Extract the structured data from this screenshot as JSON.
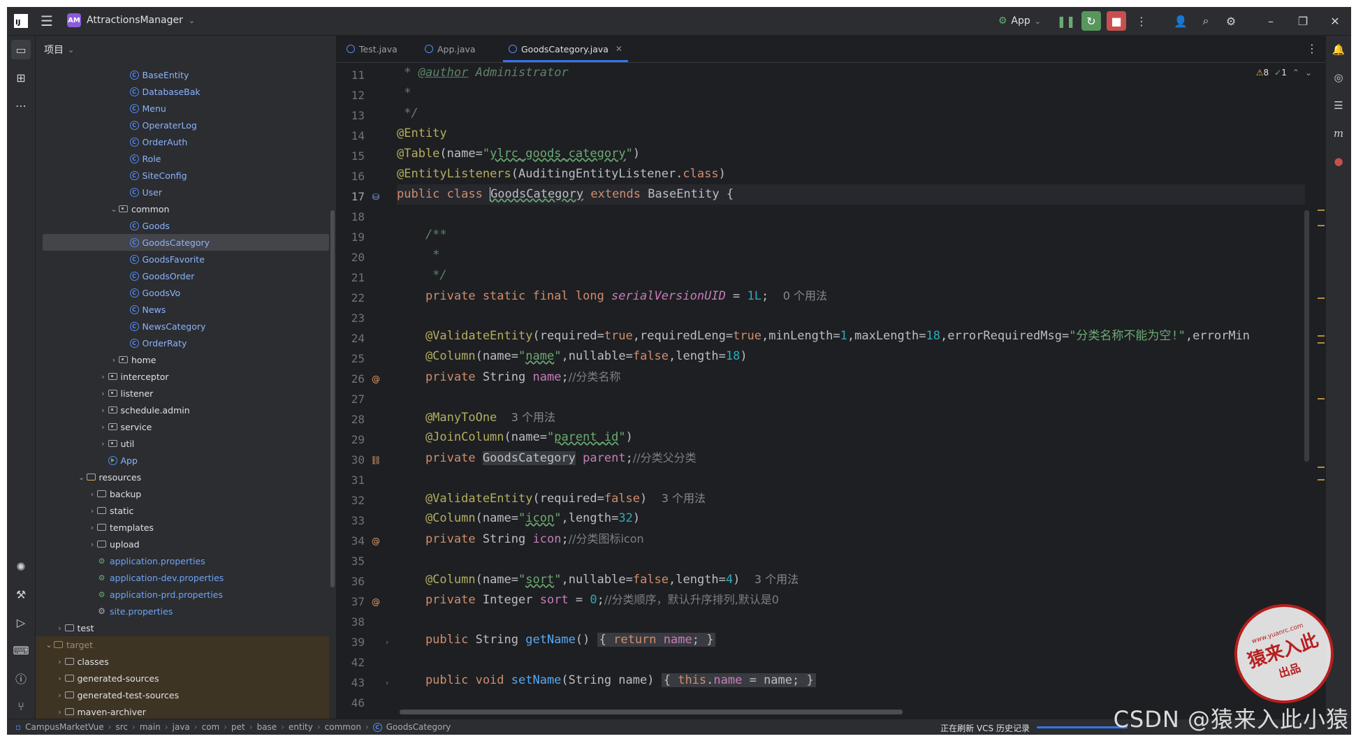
{
  "titlebar": {
    "project_badge": "AM",
    "project_name": "AttractionsManager",
    "run_config": "App",
    "icons": [
      "hamburger-menu-icon",
      "run-config-icon",
      "debug-icon",
      "rerun-icon",
      "stop-icon",
      "more-icon",
      "add-user-icon",
      "search-icon",
      "settings-icon"
    ],
    "window_controls": [
      "minimize",
      "restore",
      "close"
    ]
  },
  "project_panel": {
    "title": "项目",
    "tree": [
      {
        "label": "BaseEntity",
        "kind": "class",
        "depth": 8
      },
      {
        "label": "DatabaseBak",
        "kind": "class",
        "depth": 8
      },
      {
        "label": "Menu",
        "kind": "class",
        "depth": 8
      },
      {
        "label": "OperaterLog",
        "kind": "class",
        "depth": 8
      },
      {
        "label": "OrderAuth",
        "kind": "class",
        "depth": 8
      },
      {
        "label": "Role",
        "kind": "class",
        "depth": 8
      },
      {
        "label": "SiteConfig",
        "kind": "class",
        "depth": 8
      },
      {
        "label": "User",
        "kind": "class",
        "depth": 8
      },
      {
        "label": "common",
        "kind": "package",
        "depth": 7,
        "expanded": true
      },
      {
        "label": "Goods",
        "kind": "class",
        "depth": 8
      },
      {
        "label": "GoodsCategory",
        "kind": "class",
        "depth": 8,
        "selected": true
      },
      {
        "label": "GoodsFavorite",
        "kind": "class",
        "depth": 8
      },
      {
        "label": "GoodsOrder",
        "kind": "class",
        "depth": 8
      },
      {
        "label": "GoodsVo",
        "kind": "class",
        "depth": 8
      },
      {
        "label": "News",
        "kind": "class",
        "depth": 8
      },
      {
        "label": "NewsCategory",
        "kind": "class",
        "depth": 8
      },
      {
        "label": "OrderRaty",
        "kind": "class",
        "depth": 8
      },
      {
        "label": "home",
        "kind": "package",
        "depth": 7,
        "expanded": false
      },
      {
        "label": "interceptor",
        "kind": "package",
        "depth": 6,
        "expanded": false
      },
      {
        "label": "listener",
        "kind": "package",
        "depth": 6,
        "expanded": false
      },
      {
        "label": "schedule.admin",
        "kind": "package",
        "depth": 6,
        "expanded": false
      },
      {
        "label": "service",
        "kind": "package",
        "depth": 6,
        "expanded": false
      },
      {
        "label": "util",
        "kind": "package",
        "depth": 6,
        "expanded": false
      },
      {
        "label": "App",
        "kind": "app",
        "depth": 6
      },
      {
        "label": "resources",
        "kind": "resources",
        "depth": 4,
        "expanded": true
      },
      {
        "label": "backup",
        "kind": "folder",
        "depth": 5,
        "expanded": false
      },
      {
        "label": "static",
        "kind": "folder",
        "depth": 5,
        "expanded": false
      },
      {
        "label": "templates",
        "kind": "folder",
        "depth": 5,
        "expanded": false
      },
      {
        "label": "upload",
        "kind": "folder",
        "depth": 5,
        "expanded": false
      },
      {
        "label": "application.properties",
        "kind": "properties",
        "depth": 5
      },
      {
        "label": "application-dev.properties",
        "kind": "properties",
        "depth": 5
      },
      {
        "label": "application-prd.properties",
        "kind": "properties",
        "depth": 5
      },
      {
        "label": "site.properties",
        "kind": "settings",
        "depth": 5
      },
      {
        "label": "test",
        "kind": "folder",
        "depth": 2,
        "expanded": false
      },
      {
        "label": "target",
        "kind": "folder-excluded",
        "depth": 1,
        "expanded": true
      },
      {
        "label": "classes",
        "kind": "folder",
        "depth": 2,
        "expanded": false,
        "excluded": true
      },
      {
        "label": "generated-sources",
        "kind": "folder",
        "depth": 2,
        "expanded": false,
        "excluded": true
      },
      {
        "label": "generated-test-sources",
        "kind": "folder",
        "depth": 2,
        "expanded": false,
        "excluded": true
      },
      {
        "label": "maven-archiver",
        "kind": "folder",
        "depth": 2,
        "expanded": false,
        "excluded": true
      }
    ]
  },
  "editor": {
    "tabs": [
      {
        "label": "Test.java",
        "active": false
      },
      {
        "label": "App.java",
        "active": false
      },
      {
        "label": "GoodsCategory.java",
        "active": true
      }
    ],
    "inspection": {
      "warnings": "8",
      "ok": "1"
    },
    "current_line": "17",
    "lines": [
      {
        "no": "11",
        "t1": " * ",
        "t2": "@author",
        "t3": " Administrator"
      },
      {
        "no": "12",
        "t1": " *"
      },
      {
        "no": "13",
        "t1": " */"
      },
      {
        "no": "14",
        "t1": "@Entity"
      },
      {
        "no": "15",
        "t1": "@Table",
        "t2": "(name=",
        "t3": "\"",
        "t4": "ylrc_goods_category",
        "t5": "\"",
        "t6": ")"
      },
      {
        "no": "16",
        "t1": "@",
        "t2": "EntityListeners",
        "t3": "(AuditingEntityListener.",
        "t4": "class",
        "t5": ")"
      },
      {
        "no": "17",
        "t1": "public class ",
        "t2": "GoodsCategory",
        "t3": " extends ",
        "t4": "BaseEntity {"
      },
      {
        "no": "18"
      },
      {
        "no": "19",
        "t1": "    /**"
      },
      {
        "no": "20",
        "t1": "     *"
      },
      {
        "no": "21",
        "t1": "     */"
      },
      {
        "no": "22",
        "t1": "    private static final long ",
        "t2": "serialVersionUID",
        "t3": " = ",
        "t4": "1L",
        "t5": ";",
        "hint": "0 个用法"
      },
      {
        "no": "23"
      },
      {
        "no": "24",
        "t1": "    @ValidateEntity",
        "t2": "(required=",
        "t3": "true",
        "t4": ",requiredLeng=",
        "t5": "true",
        "t6": ",minLength=",
        "t7": "1",
        "t8": ",maxLength=",
        "t9": "18",
        "t10": ",errorRequiredMsg=",
        "t11": "\"分类名称不能为空!\"",
        "t12": ",errorMin"
      },
      {
        "no": "25",
        "t1": "    @Column",
        "t2": "(name=",
        "t3": "\"",
        "t4": "name",
        "t5": "\"",
        "t6": ",nullable=",
        "t7": "false",
        "t8": ",length=",
        "t9": "18",
        "t10": ")"
      },
      {
        "no": "26",
        "t1": "    private ",
        "t2": "String ",
        "t3": "name",
        "t4": ";",
        "cmt": "//分类名称"
      },
      {
        "no": "27"
      },
      {
        "no": "28",
        "t1": "    @ManyToOne",
        "hint": "3 个用法"
      },
      {
        "no": "29",
        "t1": "    @JoinColumn",
        "t2": "(name=",
        "t3": "\"",
        "t4": "parent_id",
        "t5": "\"",
        "t6": ")"
      },
      {
        "no": "30",
        "t1": "    private ",
        "t2": "GoodsCategory",
        "t3": " ",
        "t4": "parent",
        "t5": ";",
        "cmt": "//分类父分类"
      },
      {
        "no": "31"
      },
      {
        "no": "32",
        "t1": "    @ValidateEntity",
        "t2": "(required=",
        "t3": "false",
        "t4": ")",
        "hint": "3 个用法"
      },
      {
        "no": "33",
        "t1": "    @Column",
        "t2": "(name=",
        "t3": "\"",
        "t4": "icon",
        "t5": "\"",
        "t6": ",length=",
        "t7": "32",
        "t8": ")"
      },
      {
        "no": "34",
        "t1": "    private ",
        "t2": "String ",
        "t3": "icon",
        "t4": ";",
        "cmt": "//分类图标icon"
      },
      {
        "no": "35"
      },
      {
        "no": "36",
        "t1": "    @Column",
        "t2": "(name=",
        "t3": "\"",
        "t4": "sort",
        "t5": "\"",
        "t6": ",nullable=",
        "t7": "false",
        "t8": ",length=",
        "t9": "4",
        "t10": ")",
        "hint": "3 个用法"
      },
      {
        "no": "37",
        "t1": "    private ",
        "t2": "Integer ",
        "t3": "sort",
        "t4": " = ",
        "t5": "0",
        "t6": ";",
        "cmt": "//分类顺序，默认升序排列,默认是0"
      },
      {
        "no": "38"
      },
      {
        "no": "39",
        "t1": "    public ",
        "t2": "String ",
        "t3": "getName",
        "t4": "() ",
        "t5": "{ ",
        "t6": "return ",
        "t7": "name",
        "t8": "; ",
        "t9": "}"
      },
      {
        "no": "42"
      },
      {
        "no": "43",
        "t1": "    public void ",
        "t2": "setName",
        "t3": "(String name) ",
        "t4": "{ ",
        "t5": "this",
        "t6": ".",
        "t7": "name",
        "t8": " = name; ",
        "t9": "}"
      },
      {
        "no": "46"
      }
    ]
  },
  "statusbar": {
    "breadcrumbs": [
      "CampusMarketVue",
      "src",
      "main",
      "java",
      "com",
      "pet",
      "base",
      "entity",
      "common",
      "GoodsCategory"
    ],
    "status_text": "正在刷新 VCS 历史记录"
  },
  "watermark": {
    "text": "CSDN @猿来入此小猿",
    "stamp_top": "www.yuanrc.com",
    "stamp_mid": "猿来入此",
    "stamp_bot": "出品"
  },
  "colors": {
    "background": "#1e1f22",
    "panel": "#2b2d30",
    "keyword": "#cf8e6d",
    "annotation": "#b3ae60",
    "string": "#6aab73",
    "number": "#2aacb8",
    "field": "#c77dbb",
    "method": "#56a8f5",
    "accent": "#3574f0"
  }
}
